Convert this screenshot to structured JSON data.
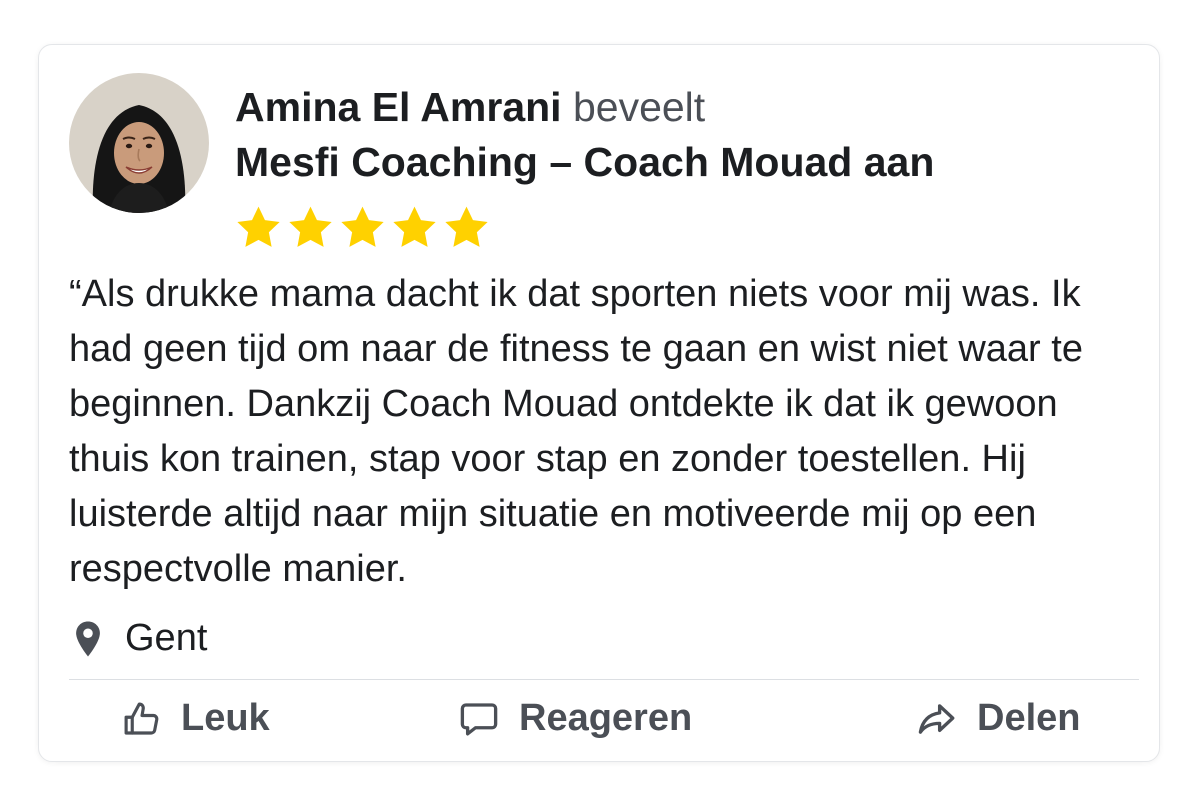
{
  "post": {
    "author": "Amina El Amrani",
    "verb": "beveelt",
    "page": "Mesfi Coaching – Coach Mouad",
    "suffix": "aan",
    "rating": 5,
    "rating_max": 5,
    "review": "“Als drukke mama dacht ik dat sporten niets voor mij was. Ik had geen tijd om naar de fitness te gaan en wist niet waar te beginnen. Dankzij Coach Mouad ontdekte ik dat ik gewoon thuis kon trainen, stap voor stap en zonder toestellen. Hij luisterde altijd naar mijn situatie en motiveerde mij op een respectvolle manier.",
    "location": "Gent"
  },
  "actions": {
    "like_label": "Leuk",
    "comment_label": "Reageren",
    "share_label": "Delen"
  },
  "icons": {
    "avatar": "avatar-photo",
    "star": "star-icon",
    "location": "map-pin-icon",
    "like": "thumbs-up-icon",
    "comment": "speech-bubble-icon",
    "share": "share-arrow-icon"
  },
  "colors": {
    "star": "#FFD100",
    "text": "#1c1e21",
    "muted": "#4b4f56",
    "border": "#e4e6e9"
  }
}
